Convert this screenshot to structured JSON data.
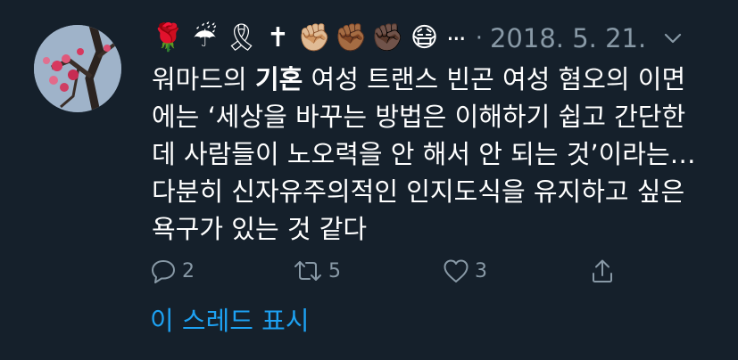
{
  "header": {
    "emojis": [
      {
        "icon": "rose-emoji",
        "glyph": "🌹"
      },
      {
        "icon": "umbrella-emoji",
        "glyph": "☔"
      },
      {
        "icon": "yellow-ribbon-emoji",
        "glyph": "🎗"
      },
      {
        "icon": "latin-cross-emoji",
        "glyph": "✝"
      },
      {
        "icon": "raised-fist-light-emoji",
        "glyph": "✊🏼"
      },
      {
        "icon": "raised-fist-medium-dark-emoji",
        "glyph": "✊🏾"
      },
      {
        "icon": "raised-fist-dark-emoji",
        "glyph": "✊🏿"
      },
      {
        "icon": "mask-face-emoji",
        "glyph": "😷"
      }
    ],
    "ellipsis": "···",
    "separator": "·",
    "date": "2018. 5. 21."
  },
  "tweet": {
    "text_before": "워마드의 ",
    "keyword": "기혼",
    "text_after": " 여성 트랜스 빈곤 여성 혐오의 이면\n에는 ‘세상을 바꾸는 방법은 이해하기 쉽고 간단한\n데 사람들이 노오력을 안 해서 안 되는 것’이라는…\n다분히 신자유주의적인 인지도식을 유지하고 싶은\n욕구가 있는 것 같다"
  },
  "actions": {
    "reply_count": "2",
    "retweet_count": "5",
    "like_count": "3"
  },
  "thread_link": "이 스레드 표시",
  "colors": {
    "background": "#15202b",
    "secondary_text": "#8899a6",
    "link": "#1da1f2"
  }
}
